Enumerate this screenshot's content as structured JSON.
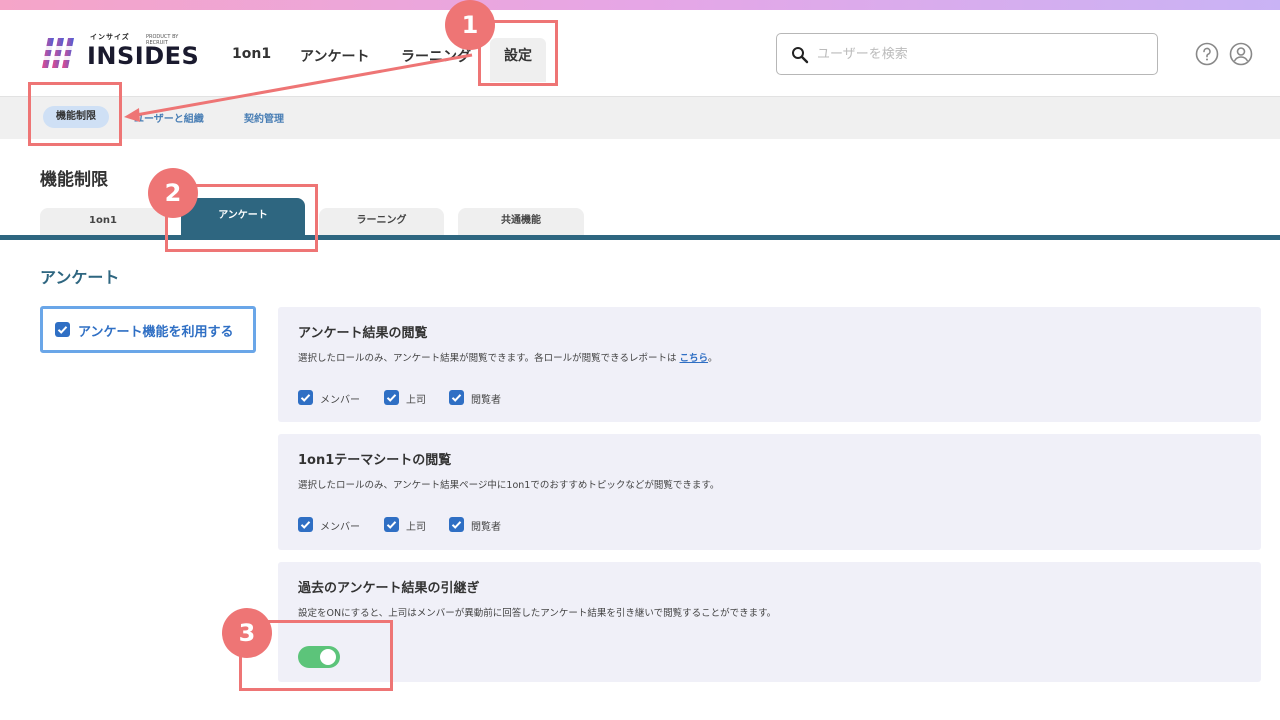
{
  "header": {
    "logo_text": "INSIDES",
    "logo_kana": "インサイズ",
    "logo_product": "PRODUCT BY RECRUIT",
    "nav": [
      "1on1",
      "アンケート",
      "ラーニング"
    ],
    "nav_active": "設定",
    "search_placeholder": "ユーザーを検索"
  },
  "subnav": {
    "active": "機能制限",
    "items": [
      "ユーザーと組織",
      "契約管理"
    ]
  },
  "page": {
    "title": "機能制限",
    "tabs": [
      "1on1",
      "アンケート",
      "ラーニング",
      "共通機能"
    ],
    "active_tab": "アンケート",
    "section_title": "アンケート"
  },
  "feature": {
    "label": "アンケート機能を利用する",
    "checked": true
  },
  "panels": [
    {
      "title": "アンケート結果の閲覧",
      "desc": "選択したロールのみ、アンケート結果が閲覧できます。各ロールが閲覧できるレポートは",
      "link": "こちら",
      "desc_end": "。",
      "roles": [
        "メンバー",
        "上司",
        "閲覧者"
      ]
    },
    {
      "title": "1on1テーマシートの閲覧",
      "desc": "選択したロールのみ、アンケート結果ページ中に1on1でのおすすめトピックなどが閲覧できます。",
      "roles": [
        "メンバー",
        "上司",
        "閲覧者"
      ]
    },
    {
      "title": "過去のアンケート結果の引継ぎ",
      "desc": "設定をONにすると、上司はメンバーが異動前に回答したアンケート結果を引き継いで閲覧することができます。",
      "toggle_on": true
    }
  ],
  "annotations": [
    "1",
    "2",
    "3"
  ],
  "colors": {
    "accent": "#2e6680",
    "link": "#2f6fc4",
    "annotation": "#ee7575",
    "toggle": "#5cc47a"
  }
}
